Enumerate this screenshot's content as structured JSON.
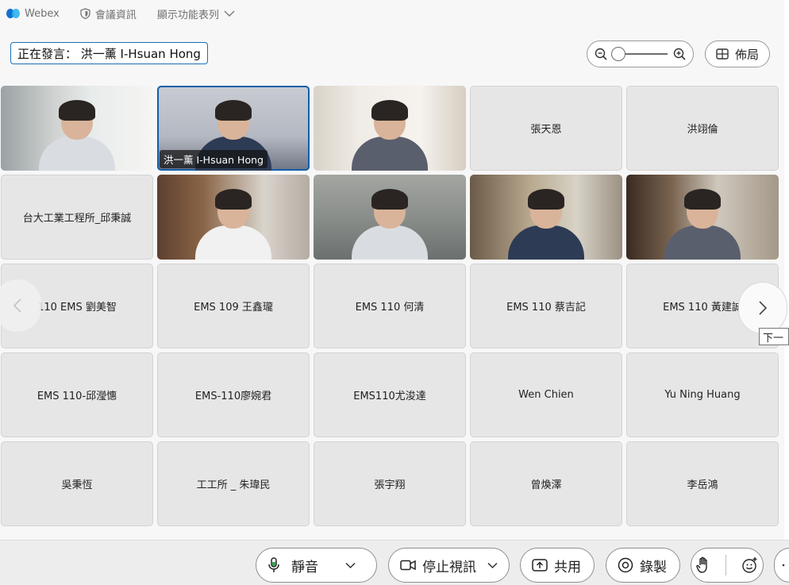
{
  "topbar": {
    "app_name": "Webex",
    "meeting_info": "會議資訊",
    "show_menu": "顯示功能表列"
  },
  "speaker": {
    "text": "正在發言： 洪一薰 I-Hsuan Hong"
  },
  "layout_button": {
    "label": "佈局"
  },
  "zoom": {
    "level": 0.0
  },
  "participants": [
    {
      "name": "",
      "video": true,
      "bg": "bg-a",
      "caption": ""
    },
    {
      "name": "",
      "video": true,
      "bg": "bg-b",
      "caption": "洪一薰 I-Hsuan Hong",
      "active": true
    },
    {
      "name": "",
      "video": true,
      "bg": "bg-c",
      "caption": ""
    },
    {
      "name": "張天恩",
      "video": false
    },
    {
      "name": "洪翊倫",
      "video": false
    },
    {
      "name": "台大工業工程所_邱秉誠",
      "video": false
    },
    {
      "name": "",
      "video": true,
      "bg": "bg-d",
      "caption": ""
    },
    {
      "name": "",
      "video": true,
      "bg": "bg-e",
      "caption": ""
    },
    {
      "name": "",
      "video": true,
      "bg": "bg-f",
      "caption": ""
    },
    {
      "name": "",
      "video": true,
      "bg": "bg-g",
      "caption": ""
    },
    {
      "name": "110 EMS 劉美智",
      "video": false
    },
    {
      "name": "EMS 109 王鑫瓏",
      "video": false
    },
    {
      "name": "EMS 110 何清",
      "video": false
    },
    {
      "name": "EMS 110 蔡吉記",
      "video": false
    },
    {
      "name": "EMS 110 黃建誠",
      "video": false
    },
    {
      "name": "EMS 110-邱瀅憓",
      "video": false
    },
    {
      "name": "EMS-110廖婉君",
      "video": false
    },
    {
      "name": "EMS110尤浚達",
      "video": false
    },
    {
      "name": "Wen Chien",
      "video": false
    },
    {
      "name": "Yu Ning Huang",
      "video": false
    },
    {
      "name": "吳秉恆",
      "video": false
    },
    {
      "name": "工工所 _ 朱瑋民",
      "video": false
    },
    {
      "name": "張宇翔",
      "video": false
    },
    {
      "name": "曾煥澤",
      "video": false
    },
    {
      "name": "李岳鴻",
      "video": false
    }
  ],
  "nav": {
    "next_tooltip": "下一"
  },
  "controls": {
    "mute_label": "靜音",
    "stop_video_label": "停止視訊",
    "share_label": "共用",
    "record_label": "錄製"
  },
  "colors": {
    "accent": "#1c6fb7",
    "active_border": "#125ea9"
  }
}
